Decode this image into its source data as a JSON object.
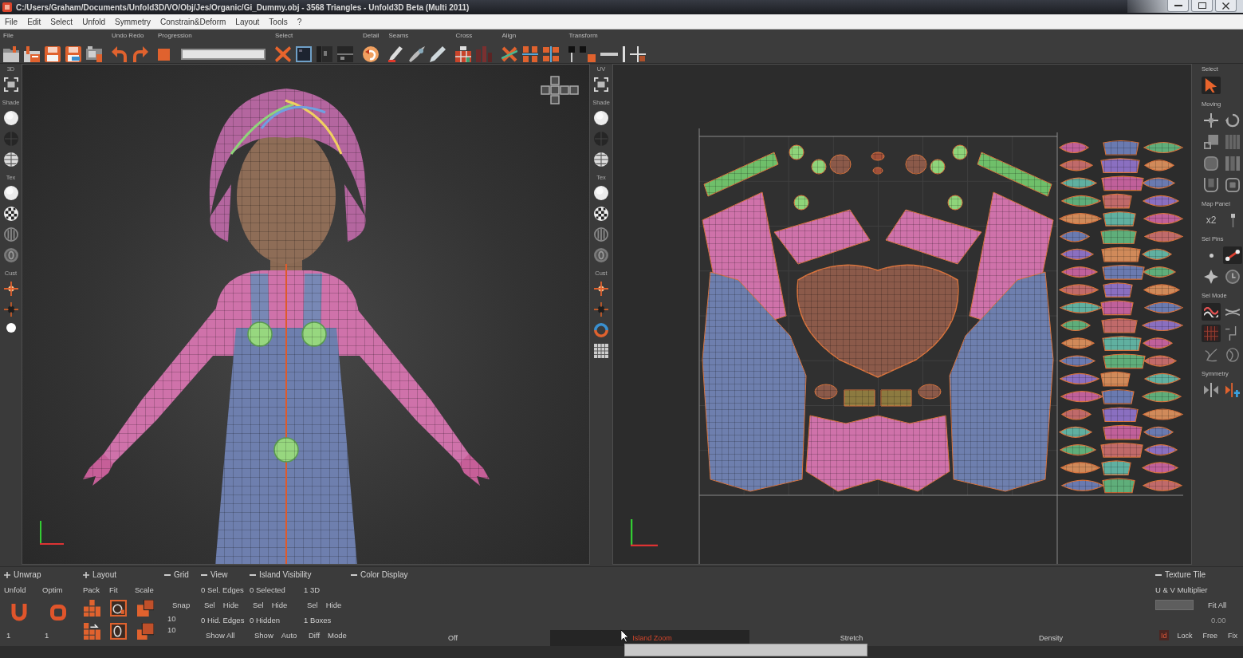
{
  "window": {
    "title": "C:/Users/Graham/Documents/Unfold3D/VO/Obj/Jes/Organic/Gi_Dummy.obj - 3568 Triangles - Unfold3D Beta (Multi 2011)"
  },
  "menu": [
    {
      "label": "File"
    },
    {
      "label": "Edit"
    },
    {
      "label": "Select"
    },
    {
      "label": "Unfold"
    },
    {
      "label": "Symmetry"
    },
    {
      "label": "Constrain&Deform"
    },
    {
      "label": "Layout"
    },
    {
      "label": "Tools"
    },
    {
      "label": "?"
    }
  ],
  "toolbar": {
    "groups": [
      {
        "label": "File",
        "kind": "icons"
      },
      {
        "label": "Undo Redo",
        "kind": "icons"
      },
      {
        "label": "Progression",
        "kind": "progress",
        "level": 1
      },
      {
        "label": "Select",
        "kind": "icons"
      },
      {
        "label": "Detail",
        "kind": "icons"
      },
      {
        "label": "Seams",
        "kind": "icons"
      },
      {
        "label": "Cross",
        "kind": "icons"
      },
      {
        "label": "Align",
        "kind": "icons"
      },
      {
        "label": "Transform",
        "kind": "icons"
      }
    ]
  },
  "view_3d": {
    "strip": [
      {
        "label": "3D"
      },
      {
        "label": "Shade"
      },
      {
        "label": "Tex"
      },
      {
        "label": "Cust"
      }
    ]
  },
  "view_uv": {
    "strip": [
      {
        "label": "UV"
      },
      {
        "label": "Shade"
      },
      {
        "label": "Tex"
      },
      {
        "label": "Cust"
      }
    ]
  },
  "tools_panel": {
    "sections": [
      {
        "label": "Select",
        "tools": [
          {
            "selected": true
          }
        ]
      },
      {
        "label": "Moving",
        "tools": [
          {
            "selected": false
          },
          {
            "selected": false
          },
          {
            "selected": false
          },
          {
            "selected": false
          },
          {
            "selected": false
          },
          {
            "selected": false
          },
          {
            "selected": false
          },
          {
            "selected": false
          }
        ]
      },
      {
        "label": "Map Panel",
        "text": "x2",
        "tools": [
          {
            "selected": false
          }
        ]
      },
      {
        "label": "Sel Pins",
        "tools": [
          {
            "selected": false
          },
          {
            "selected": true
          },
          {
            "selected": false
          },
          {
            "selected": false
          }
        ]
      },
      {
        "label": "Sel Mode",
        "tools": [
          {
            "selected": true
          },
          {
            "selected": false
          },
          {
            "selected": true
          },
          {
            "selected": false
          },
          {
            "selected": false
          },
          {
            "selected": false
          }
        ]
      },
      {
        "label": "Symmetry",
        "tools": [
          {
            "selected": false
          },
          {
            "selected": false
          }
        ]
      }
    ]
  },
  "bottom_panel": {
    "unwrap": {
      "title": "Unwrap",
      "expanded": false,
      "items": [
        {
          "label": "Unfold",
          "value": "1"
        },
        {
          "label": "Optim",
          "value": "1"
        }
      ]
    },
    "layout": {
      "title": "Layout",
      "expanded": false,
      "items": [
        {
          "label": "Pack"
        },
        {
          "label": "Fit"
        },
        {
          "label": "Scale"
        }
      ]
    },
    "grid": {
      "title": "Grid",
      "expanded": true,
      "label": "Snap",
      "values": [
        "10",
        "10"
      ]
    },
    "view": {
      "title": "View",
      "expanded": true,
      "stats": [
        "0 Sel. Edges",
        "0 Hid. Edges"
      ],
      "buttons": [
        "Sel",
        "Hide"
      ],
      "footer": [
        "Show All"
      ]
    },
    "island_visibility": {
      "title": "Island Visibility",
      "expanded": true,
      "columns": [
        {
          "stats": [
            "0 Selected",
            "0 Hidden"
          ],
          "buttons": [
            "Sel",
            "Hide"
          ],
          "footer": [
            "Show",
            "Auto"
          ]
        },
        {
          "stats": [
            "1 3D",
            "1 Boxes"
          ],
          "buttons": [
            "Sel",
            "Hide"
          ],
          "footer": [
            "Diff",
            "Mode"
          ]
        }
      ]
    },
    "color_display": {
      "title": "Color Display",
      "expanded": true,
      "modes": [
        {
          "label": "Off",
          "selected": false
        },
        {
          "label": "Island Zoom",
          "selected": true
        },
        {
          "label": "Stretch",
          "selected": false
        },
        {
          "label": "Density",
          "selected": false
        }
      ]
    },
    "texture_tile": {
      "title": "Texture Tile",
      "expanded": true,
      "label": "U & V Multiplier",
      "button": "Fit All",
      "reading": "0.00",
      "options": [
        {
          "label": "Id",
          "selected": true
        },
        {
          "label": "Lock",
          "selected": false
        },
        {
          "label": "Free",
          "selected": false
        },
        {
          "label": "Fix",
          "selected": false
        }
      ]
    }
  }
}
